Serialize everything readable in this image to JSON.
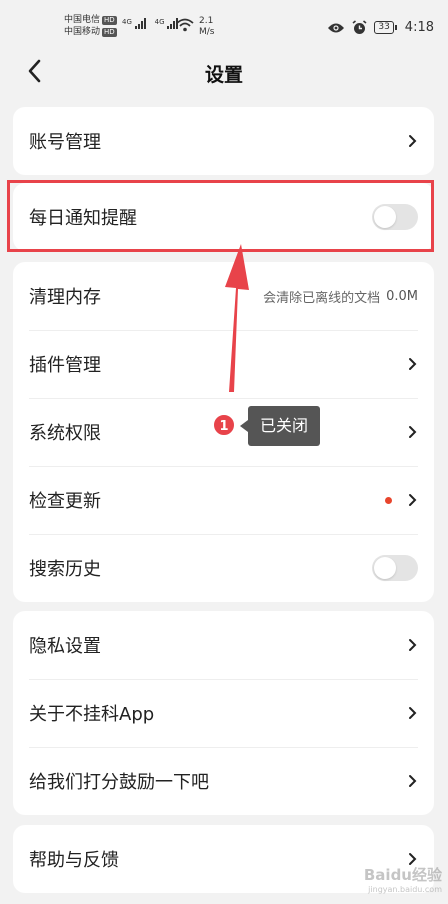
{
  "status_bar": {
    "carrier_1": "中国电信",
    "carrier_2": "中国移动",
    "hd_1": "HD",
    "hd_2": "HD",
    "net_1": "4G",
    "net_2": "4G",
    "speed_value": "2.1",
    "speed_unit": "M/s",
    "battery": "33",
    "time": "4:18"
  },
  "nav": {
    "title": "设置"
  },
  "sections": {
    "account": {
      "label": "账号管理"
    },
    "daily_notify": {
      "label": "每日通知提醒",
      "enabled": false
    },
    "clear_cache": {
      "label": "清理内存",
      "note": "会清除已离线的文档",
      "value": "0.0M"
    },
    "plugins": {
      "label": "插件管理"
    },
    "permissions": {
      "label": "系统权限"
    },
    "updates": {
      "label": "检查更新",
      "has_new": true
    },
    "search_history": {
      "label": "搜索历史",
      "enabled": false
    },
    "privacy": {
      "label": "隐私设置"
    },
    "about": {
      "label": "关于不挂科App"
    },
    "rate": {
      "label": "给我们打分鼓励一下吧"
    },
    "help": {
      "label": "帮助与反馈"
    }
  },
  "annotation": {
    "step": "1",
    "text": "已关闭",
    "color": "#e8434a"
  },
  "watermark": {
    "text": "Baidu经验",
    "sub": "jingyan.baidu.com"
  },
  "colors": {
    "accent": "#e8434a",
    "dot": "#e8452c",
    "toggle_off": "#e4e4e4"
  }
}
